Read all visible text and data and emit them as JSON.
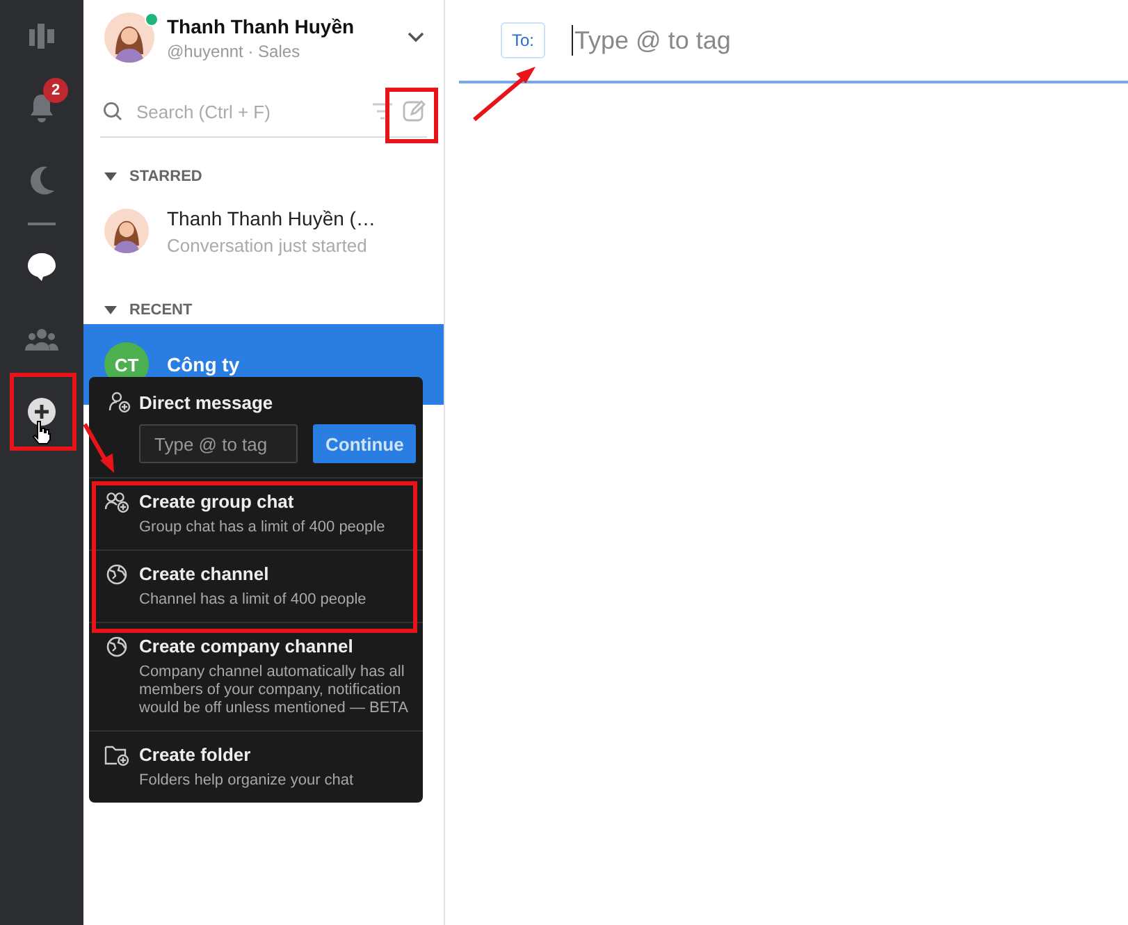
{
  "rail": [
    {
      "kind": "logo",
      "selected": false
    },
    {
      "kind": "bell",
      "selected": false,
      "badge": "2"
    },
    {
      "kind": "moon",
      "selected": false
    },
    {
      "kind": "divider"
    },
    {
      "kind": "chat",
      "selected": true
    },
    {
      "kind": "people",
      "selected": false
    },
    {
      "kind": "plus",
      "selected": false
    }
  ],
  "profile": {
    "name": "Thanh Thanh Huyền",
    "subtitle": "@huyennt · Sales",
    "online": true
  },
  "search": {
    "placeholder": "Search (Ctrl + F)"
  },
  "sections": [
    {
      "title": "STARRED",
      "expanded": true,
      "items": [
        {
          "name": "Thanh Thanh Huyền (…",
          "preview": "Conversation just started",
          "kind": "picture",
          "selected": false
        }
      ]
    },
    {
      "title": "RECENT",
      "expanded": true,
      "items": [
        {
          "name": "Công ty",
          "initials": "CT",
          "kind": "initials",
          "color": "#4caf50",
          "selected": true
        }
      ]
    }
  ],
  "menu": {
    "direct": {
      "title": "Direct message",
      "placeholder": "Type @ to tag",
      "button": "Continue"
    },
    "items": [
      {
        "kind": "group",
        "title": "Create group chat",
        "description": "Group chat has a limit of 400 people"
      },
      {
        "kind": "channel",
        "title": "Create channel",
        "description": "Channel has a limit of 400 people"
      },
      {
        "kind": "channel",
        "title": "Create company channel",
        "description": "Company channel automatically has all members of your company, notification would be off unless mentioned — BETA"
      },
      {
        "kind": "folder",
        "title": "Create folder",
        "description": "Folders help organize your chat"
      }
    ]
  },
  "compose": {
    "to_label": "To:",
    "placeholder": "Type @ to tag"
  }
}
